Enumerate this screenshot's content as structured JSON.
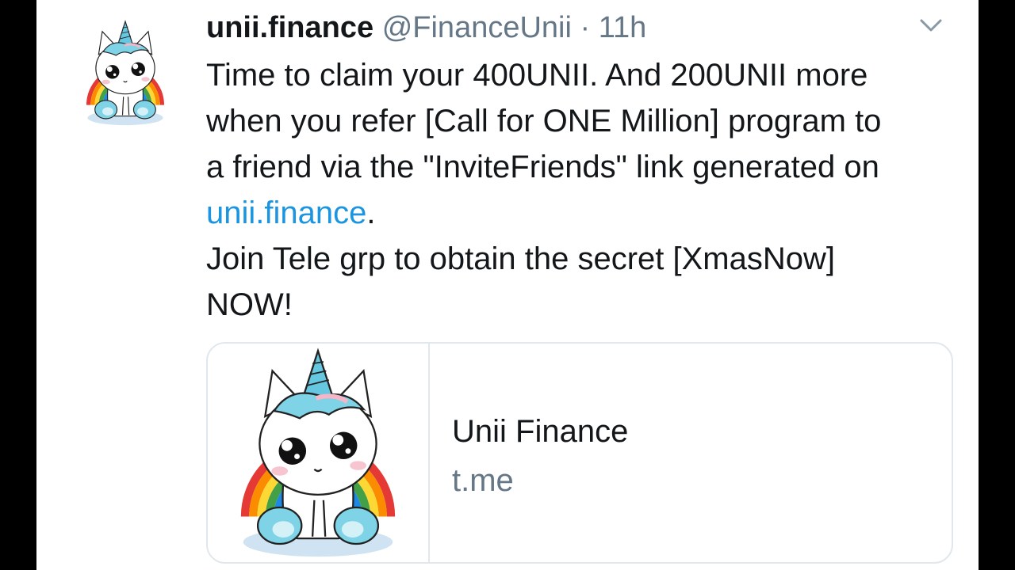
{
  "tweet": {
    "display_name": "unii.finance",
    "handle": "@FinanceUnii",
    "separator": "·",
    "time": "11h",
    "lines": {
      "l1": "Time to claim your 400UNII. And 200UNII more",
      "l2": "when you refer [Call for ONE Million] program to",
      "l3": "a friend via the \"InviteFriends\" link generated on",
      "l4_link": "unii.finance",
      "l4_tail": ".",
      "l5": "Join Tele grp to obtain the secret [XmasNow]",
      "l6": "NOW!"
    }
  },
  "card": {
    "title": "Unii Finance",
    "domain": "t.me"
  },
  "icons": {
    "avatar": "unicorn-avatar-icon",
    "menu": "chevron-down-icon",
    "card_image": "unicorn-card-image"
  },
  "colors": {
    "link": "#1b95e0",
    "muted": "#657786",
    "text": "#14171a",
    "border": "#e1e8ed"
  }
}
